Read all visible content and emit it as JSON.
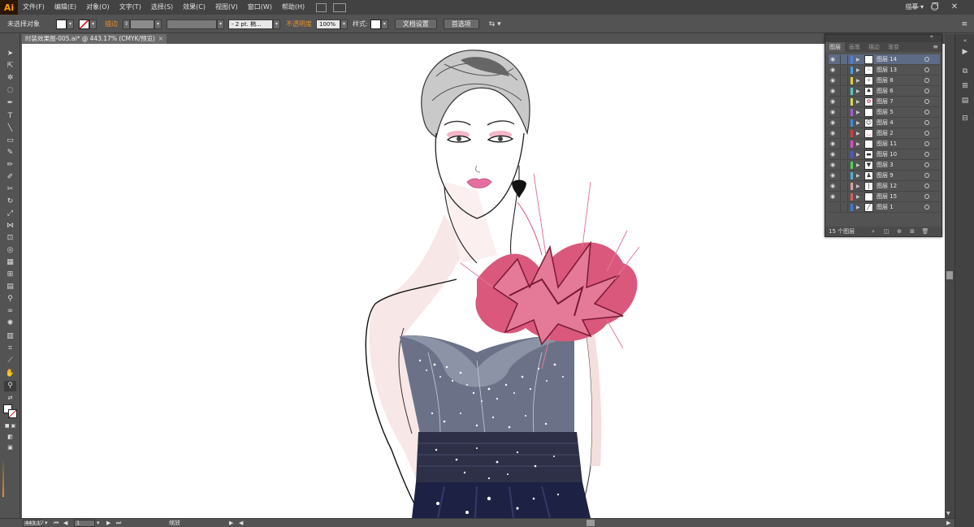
{
  "app": {
    "logo": "Ai",
    "workspace": "描摹 ▾"
  },
  "menu": [
    "文件(F)",
    "编辑(E)",
    "对象(O)",
    "文字(T)",
    "选择(S)",
    "效果(C)",
    "视图(V)",
    "窗口(W)",
    "帮助(H)"
  ],
  "window_controls": {
    "minimize": "—",
    "restore": "❐",
    "close": "✕"
  },
  "control_bar": {
    "selection_status": "未选择对象",
    "stroke_label": "描边",
    "stroke_weight": "- 2 pt. 椭...",
    "opacity_label": "不透明度",
    "opacity_value": "100%",
    "style_label": "样式:",
    "doc_setup_button": "文档设置",
    "preferences_button": "首选项"
  },
  "document_tab": {
    "title": "时装效果图-005.ai* @ 443.17% (CMYK/预览)",
    "close": "×"
  },
  "layers_panel": {
    "tabs": [
      "图层",
      "画笔",
      "描边",
      "渐变"
    ],
    "active_tab": 0,
    "layers": [
      {
        "name": "图层 14",
        "color": "#4f7fe0",
        "visible": true,
        "selected": true,
        "thumb": "blank"
      },
      {
        "name": "图层 13",
        "color": "#3ea0e8",
        "visible": true,
        "selected": false,
        "thumb": "dots"
      },
      {
        "name": "图层 8",
        "color": "#e0d03a",
        "visible": true,
        "selected": false,
        "thumb": "figure"
      },
      {
        "name": "图层 6",
        "color": "#56c8c8",
        "visible": true,
        "selected": false,
        "thumb": "earring"
      },
      {
        "name": "图层 7",
        "color": "#d8d84a",
        "visible": true,
        "selected": false,
        "thumb": "flower"
      },
      {
        "name": "图层 5",
        "color": "#a55ad8",
        "visible": true,
        "selected": false,
        "thumb": "blank"
      },
      {
        "name": "图层 4",
        "color": "#3a8ee0",
        "visible": true,
        "selected": false,
        "thumb": "face"
      },
      {
        "name": "图层 2",
        "color": "#d83a3a",
        "visible": true,
        "selected": false,
        "thumb": "lips"
      },
      {
        "name": "图层 11",
        "color": "#e04ac8",
        "visible": true,
        "selected": false,
        "thumb": "blank"
      },
      {
        "name": "图层 10",
        "color": "#4a58d8",
        "visible": true,
        "selected": false,
        "thumb": "dress"
      },
      {
        "name": "图层 3",
        "color": "#4ad84a",
        "visible": true,
        "selected": false,
        "thumb": "bodice"
      },
      {
        "name": "图层 9",
        "color": "#4fb0e0",
        "visible": true,
        "selected": false,
        "thumb": "gown"
      },
      {
        "name": "图层 12",
        "color": "#e0a0a0",
        "visible": true,
        "selected": false,
        "thumb": "body"
      },
      {
        "name": "图层 15",
        "color": "#e05a5a",
        "visible": true,
        "selected": false,
        "thumb": "blank"
      },
      {
        "name": "图层 1",
        "color": "#3a7ae0",
        "visible": false,
        "selected": false,
        "thumb": "sketch"
      }
    ],
    "footer_count": "15 个图层"
  },
  "status_bar": {
    "zoom": "443.17",
    "artboard": "1",
    "tool_status": "缩放"
  },
  "colors": {
    "accent_orange": "#e8902a",
    "selection_row": "#5d6b85",
    "canvas": "#ffffff"
  }
}
